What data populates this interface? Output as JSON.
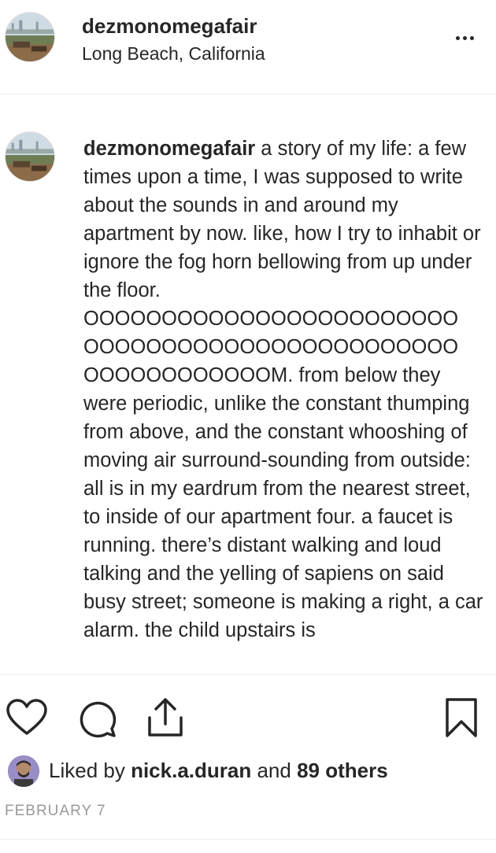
{
  "post": {
    "username": "dezmonomegafair",
    "location": "Long Beach, California"
  },
  "caption": {
    "username": "dezmonomegafair",
    "text": " a story of my life: a few times upon a time, I was supposed to write about the sounds in and around my apartment by now. like, how I try to inhabit or ignore the fog horn bellowing from up under the floor. OOOOOOOOOOOOOOOOOOOOOOOO OOOOOOOOOOOOOOOOOOOOOOOO OOOOOOOOOOOOM. from below they were periodic, unlike the constant thumping from above, and the constant whooshing of moving air surround-sounding from outside: all is in my eardrum from the nearest street, to inside of our apartment four. a faucet is running. there’s distant walking and loud talking and the yelling of sapiens on said busy street; someone is making a right, a car alarm. the child upstairs is"
  },
  "actions": {
    "like_icon": "heart-icon",
    "comment_icon": "comment-icon",
    "share_icon": "share-icon",
    "save_icon": "bookmark-icon"
  },
  "likes": {
    "prefix": "Liked by ",
    "user": "nick.a.duran",
    "joiner": " and ",
    "others": "89 others"
  },
  "date": "FEBRUARY 7"
}
